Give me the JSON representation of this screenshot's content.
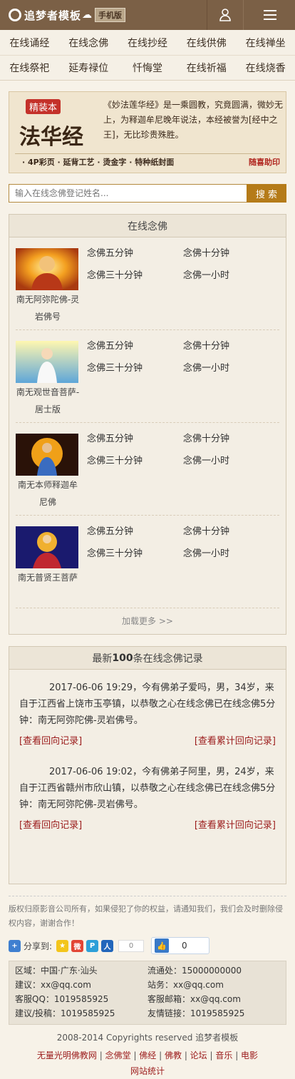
{
  "header": {
    "logo_text": "追梦者模板",
    "badge": "手机版"
  },
  "nav": {
    "row1": [
      "在线诵经",
      "在线念佛",
      "在线抄经",
      "在线供佛",
      "在线禅坐"
    ],
    "row2": [
      "在线祭祀",
      "延寿禄位",
      "忏悔堂",
      "在线祈福",
      "在线烧香"
    ]
  },
  "banner": {
    "tag": "精装本",
    "title": "法华经",
    "desc": "《妙法莲华经》是一乘圆教，究竟圆满，微妙无上，为释迦牟尼晚年说法，本经被誉为[经中之王]，无比珍贵殊胜。",
    "features": "· 4P彩页 · 延背工艺 · 烫金字 · 特种纸封面",
    "sign": "随喜助印"
  },
  "search": {
    "placeholder": "输入在线念佛登记姓名...",
    "button": "搜 索"
  },
  "nianfo": {
    "title": "在线念佛",
    "items": [
      {
        "name": "南无阿弥陀佛-灵岩佛号",
        "l1": "念佛五分钟",
        "l2": "念佛十分钟",
        "l3": "念佛三十分钟",
        "l4": "念佛一小时"
      },
      {
        "name": "南无观世音菩萨-居士版",
        "l1": "念佛五分钟",
        "l2": "念佛十分钟",
        "l3": "念佛三十分钟",
        "l4": "念佛一小时"
      },
      {
        "name": "南无本师释迦牟尼佛",
        "l1": "念佛五分钟",
        "l2": "念佛十分钟",
        "l3": "念佛三十分钟",
        "l4": "念佛一小时"
      },
      {
        "name": "南无普贤王菩萨",
        "l1": "念佛五分钟",
        "l2": "念佛十分钟",
        "l3": "念佛三十分钟",
        "l4": "念佛一小时"
      }
    ],
    "more": "加载更多 >>"
  },
  "records": {
    "title_pre": "最新",
    "title_num": "100",
    "title_post": "条在线念佛记录",
    "items": [
      {
        "text": "2017-06-06 19:29，今有佛弟子爱吗，男，34岁，来自于江西省上饶市玉亭镇，以恭敬之心在线念佛已在线念佛5分钟：南无阿弥陀佛-灵岩佛号。",
        "link1": "[查看回向记录]",
        "link2": "[查看累计回向记录]"
      },
      {
        "text": "2017-06-06 19:02，今有佛弟子阿里，男，24岁，来自于江西省赣州市欣山镇，以恭敬之心在线念佛已在线念佛5分钟：南无阿弥陀佛-灵岩佛号。",
        "link1": "[查看回向记录]",
        "link2": "[查看累计回向记录]"
      }
    ]
  },
  "copyright_note": "版权归原影音公司所有，如果侵犯了你的权益，请通知我们，我们会及时删除侵权内容，谢谢合作！",
  "share": {
    "label": "分享到:",
    "count": "0",
    "like_count": "0"
  },
  "info": [
    "区域：中国·广东·汕头",
    "流通处：15000000000",
    "建议：xx@qq.com",
    "站务：xx@qq.com",
    "客服QQ：1019585925",
    "客服邮箱：xx@qq.com",
    "建议/投稿：1019585925",
    "友情链接：1019585925"
  ],
  "footer": {
    "copy": "2008-2014 Copyrights reserved 追梦者模板",
    "links": [
      "无量光明佛教网",
      "念佛堂",
      "佛经",
      "佛教",
      "论坛",
      "音乐",
      "电影",
      "网站统计"
    ]
  },
  "colors": {
    "header": "#7b6046",
    "accent": "#b57b19",
    "link": "#9b1b1b"
  }
}
